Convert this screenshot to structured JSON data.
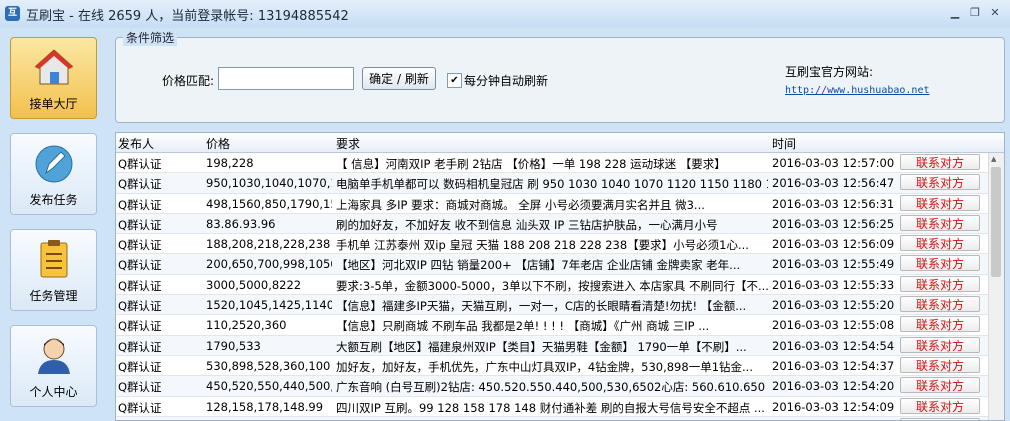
{
  "window": {
    "title": "互刷宝 - 在线 2659 人，当前登录帐号: 13194885542",
    "controls": [
      "minimize-icon",
      "restore-icon",
      "close-icon"
    ]
  },
  "sidebar": {
    "items": [
      {
        "label": "接单大厅",
        "icon": "house-icon",
        "active": true
      },
      {
        "label": "发布任务",
        "icon": "pen-icon",
        "active": false
      },
      {
        "label": "任务管理",
        "icon": "checklist-icon",
        "active": false
      },
      {
        "label": "个人中心",
        "icon": "user-icon",
        "active": false
      }
    ]
  },
  "filter": {
    "legend": "条件筛选",
    "price_label": "价格匹配:",
    "price_value": "",
    "refresh_button": "确定 / 刷新",
    "auto_refresh_label": "每分钟自动刷新",
    "auto_refresh_checked": true,
    "site_title": "互刷宝官方网站:",
    "site_url": "http://www.hushuabao.net"
  },
  "table": {
    "headers": [
      "发布人",
      "价格",
      "要求",
      "时间"
    ],
    "action_label": "联系对方",
    "rows": [
      {
        "publisher": "Q群认证",
        "price": "198,228",
        "req": "【 信息】河南双IP  老手刷  2钻店 【价格】一单 198 228   运动球迷 【要求】",
        "time": "2016-03-03 12:57:00"
      },
      {
        "publisher": "Q群认证",
        "price": "950,1030,1040,1070,1...",
        "req": "电脑单手机单都可以 数码相机皇冠店 刷 950 1030 1040 1070 1120 1150 1180 1200...",
        "time": "2016-03-03 12:56:47"
      },
      {
        "publisher": "Q群认证",
        "price": "498,1560,850,1790,15...",
        "req": "上海家具 多IP       要求：商城对商城。  全屏   小号必须要满月实名并且 微3...",
        "time": "2016-03-03 12:56:31"
      },
      {
        "publisher": "Q群认证",
        "price": "83.86.93.96",
        "req": "刷的加好友，不加好友 收不到信息  汕头双 IP  三钻店护肤品，一心满月小号",
        "time": "2016-03-03 12:56:25"
      },
      {
        "publisher": "Q群认证",
        "price": "188,208,218,228,238",
        "req": "手机单  江苏泰州 双ip  皇冠 天猫     188 208  218 228 238【要求】小号必须1心...",
        "time": "2016-03-03 12:56:09"
      },
      {
        "publisher": "Q群认证",
        "price": "200,650,700,998,1050",
        "req": "【地区】河北双IP    四钻 销量200+ 【店铺】7年老店 企业店铺  金牌卖家  老年...",
        "time": "2016-03-03 12:55:49"
      },
      {
        "publisher": "Q群认证",
        "price": "3000,5000,8222",
        "req": "要求:3-5单，金额3000-5000，3单以下不刷，按搜索进入 本店家具 不刷同行【不...",
        "time": "2016-03-03 12:55:33"
      },
      {
        "publisher": "Q群认证",
        "price": "1520,1045,1425,1140,...",
        "req": "【信息】福建多IP天猫，天猫互刷，一对一，C店的长眼睛看清楚!勿扰! 【金额...",
        "time": "2016-03-03 12:55:20"
      },
      {
        "publisher": "Q群认证",
        "price": "110,2520,360",
        "req": "【信息】只刷商城  不刷车品    我都是2单! ! ! ! 【商城】《广州 商城  三IP ...",
        "time": "2016-03-03 12:55:08"
      },
      {
        "publisher": "Q群认证",
        "price": "1790,533",
        "req": "大额互刷【地区】福建泉州双IP【类目】天猫男鞋【金额】 1790一单【不刷】...",
        "time": "2016-03-03 12:54:54"
      },
      {
        "publisher": "Q群认证",
        "price": "530,898,528,360,100",
        "req": "加好友，加好友，手机优先，广东中山灯具双IP，4钻金牌，530,898一单1钻金...",
        "time": "2016-03-03 12:54:37"
      },
      {
        "publisher": "Q群认证",
        "price": "450,520,550,440,500,...",
        "req": "广东音响 (白号互刷)2钻店: 450.520.550.440,500,530,6502心店: 560.610.650",
        "time": "2016-03-03 12:54:20"
      },
      {
        "publisher": "Q群认证",
        "price": "128,158,178,148.99",
        "req": "四川双IP 互刷。99  128  158  178 148  财付通补差 刷的自报大号信号安全不超点 ...",
        "time": "2016-03-03 12:54:09"
      },
      {
        "publisher": "Q群认证",
        "price": "100,200",
        "req": "广东江门多IP (3钻，4钻淘宝)    100-200元之间   假聊小额改价  (不刷心店，...",
        "time": "2016-03-03 12:54:04"
      }
    ]
  },
  "colors": {
    "accent": "#d41010",
    "link": "#1547a8",
    "background": "#cfe3f6"
  }
}
